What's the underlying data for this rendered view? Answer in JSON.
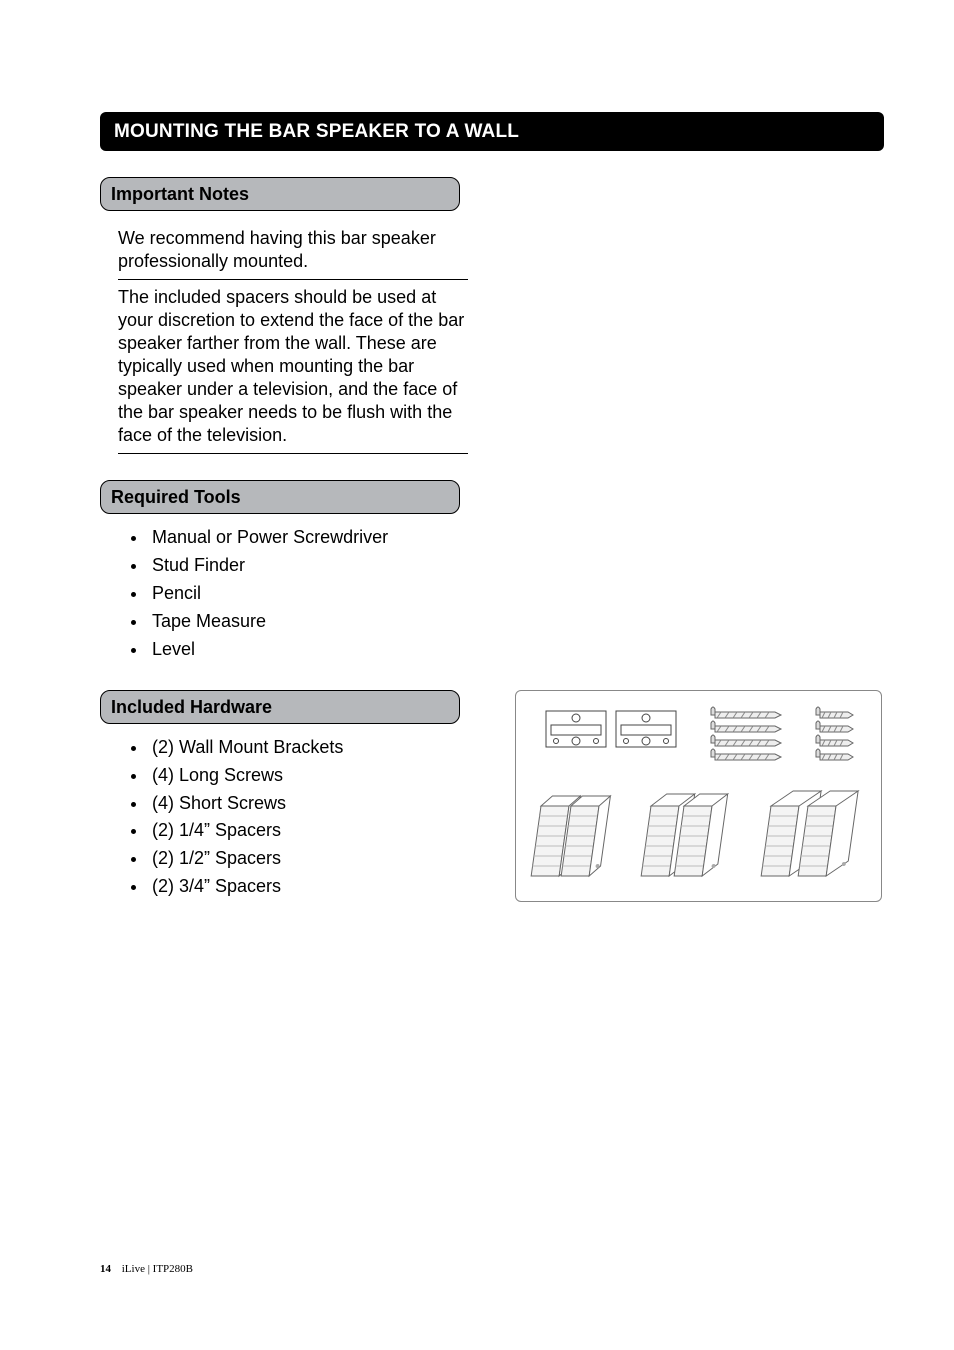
{
  "section_title": "MOUNTING THE BAR SPEAKER TO A WALL",
  "important_notes": {
    "heading": "Important Notes",
    "para1": "We recommend having this bar speaker professionally mounted.",
    "para2": "The included spacers should be used at your discretion to extend the face of the bar speaker farther from the wall. These are typically used when mounting the bar speaker under a television, and the face of the bar speaker needs to be flush with the face of the television."
  },
  "required_tools": {
    "heading": "Required Tools",
    "items": [
      "Manual or Power Screwdriver",
      "Stud Finder",
      "Pencil",
      "Tape Measure",
      "Level"
    ]
  },
  "included_hardware": {
    "heading": "Included Hardware",
    "items": [
      "(2) Wall Mount Brackets",
      "(4) Long Screws",
      "(4) Short Screws",
      "(2) 1/4” Spacers",
      "(2) 1/2” Spacers",
      "(2) 3/4” Spacers"
    ]
  },
  "footer": {
    "page_number": "14",
    "brand_model": "iLive  |  ITP280B"
  }
}
